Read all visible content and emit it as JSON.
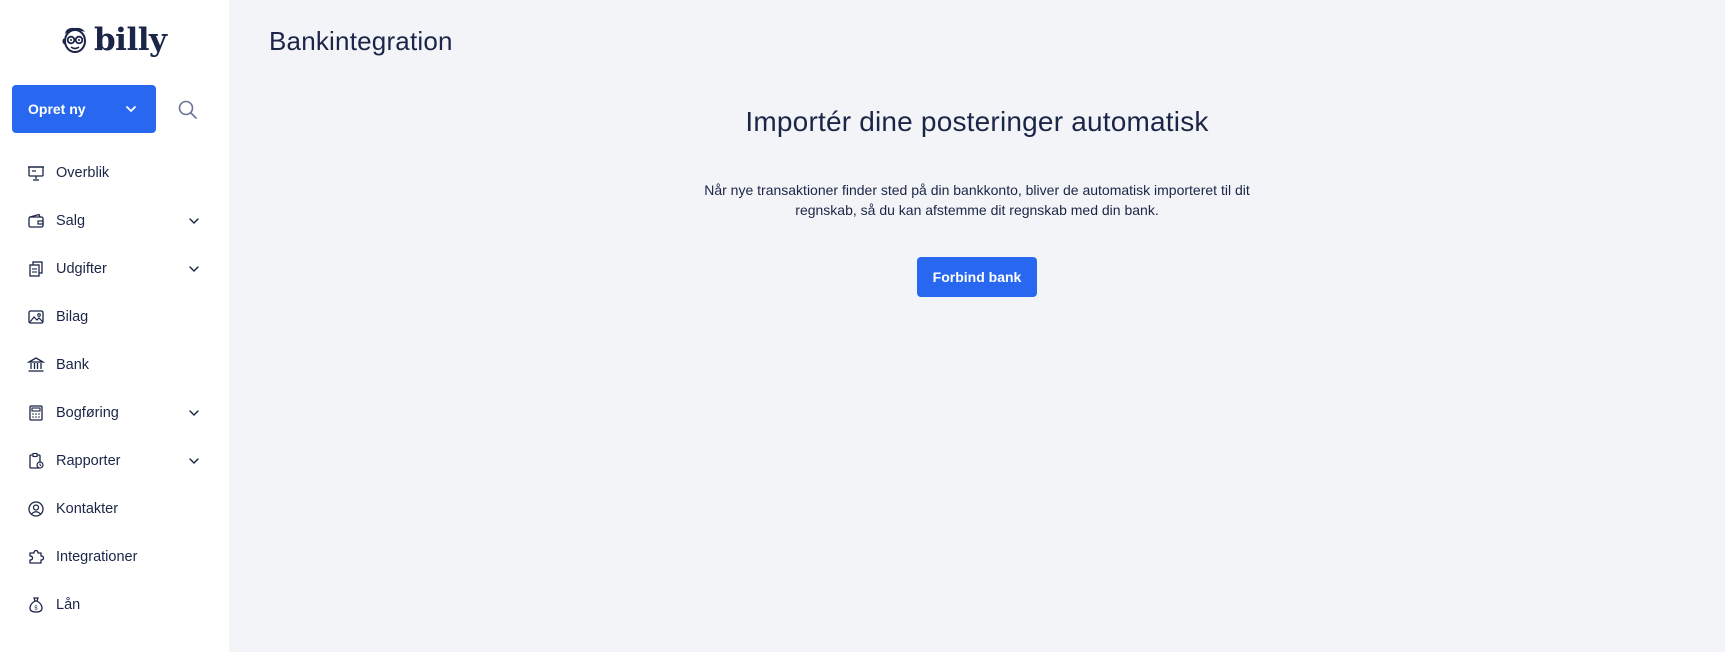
{
  "brand": {
    "name": "billy",
    "accent": "#2868f0",
    "text_color": "#1b2547",
    "bg": "#f3f4f8"
  },
  "sidebar": {
    "create_button": {
      "label": "Opret ny",
      "icon": "chevron-down-icon"
    },
    "search_icon": "search-icon",
    "items": [
      {
        "label": "Overblik",
        "icon": "presentation-icon",
        "expandable": false
      },
      {
        "label": "Salg",
        "icon": "wallet-icon",
        "expandable": true
      },
      {
        "label": "Udgifter",
        "icon": "documents-icon",
        "expandable": true
      },
      {
        "label": "Bilag",
        "icon": "image-icon",
        "expandable": false
      },
      {
        "label": "Bank",
        "icon": "bank-icon",
        "expandable": false
      },
      {
        "label": "Bogføring",
        "icon": "calculator-icon",
        "expandable": true
      },
      {
        "label": "Rapporter",
        "icon": "report-icon",
        "expandable": true
      },
      {
        "label": "Kontakter",
        "icon": "user-circle-icon",
        "expandable": false
      },
      {
        "label": "Integrationer",
        "icon": "puzzle-icon",
        "expandable": false
      },
      {
        "label": "Lån",
        "icon": "money-bag-icon",
        "expandable": false
      }
    ]
  },
  "main": {
    "title": "Bankintegration",
    "heading": "Importér dine posteringer automatisk",
    "description": "Når nye transaktioner finder sted på din bankkonto, bliver de automatisk importeret til dit regnskab, så du kan afstemme dit regnskab med din bank.",
    "connect_button": "Forbind bank"
  }
}
